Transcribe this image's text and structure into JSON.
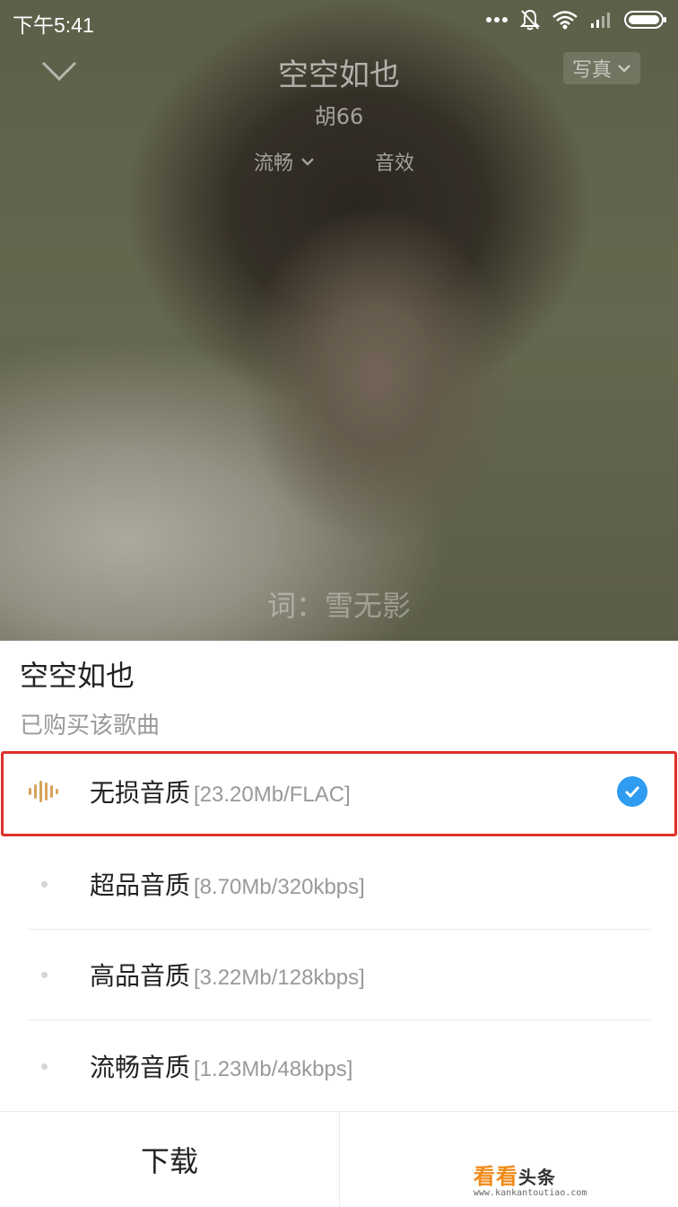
{
  "status_bar": {
    "time": "下午5:41",
    "icons": [
      "more-dots-icon",
      "bell-muted-icon",
      "wifi-icon",
      "signal-icon",
      "battery-icon"
    ]
  },
  "player": {
    "song_title": "空空如也",
    "artist": "胡66",
    "photo_button": "写真",
    "quality_label": "流畅",
    "sound_effect": "音效",
    "lyric": "词：雪无影"
  },
  "sheet": {
    "title": "空空如也",
    "subtitle": "已购买该歌曲",
    "options": [
      {
        "label": "无损音质",
        "size": "[23.20Mb/FLAC]",
        "selected": true,
        "icon": "sound-wave-icon"
      },
      {
        "label": "超品音质",
        "size": "[8.70Mb/320kbps]",
        "selected": false
      },
      {
        "label": "高品音质",
        "size": "[3.22Mb/128kbps]",
        "selected": false
      },
      {
        "label": "流畅音质",
        "size": "[1.23Mb/48kbps]",
        "selected": false
      }
    ],
    "download_label": "下载"
  },
  "watermark": {
    "text_main": "看看",
    "text_second": "头条",
    "url": "www.kankantoutiao.com"
  },
  "colors": {
    "accent": "#2e9cf0",
    "highlight": "#e0302a",
    "lossless_icon": "#d8a25a"
  }
}
